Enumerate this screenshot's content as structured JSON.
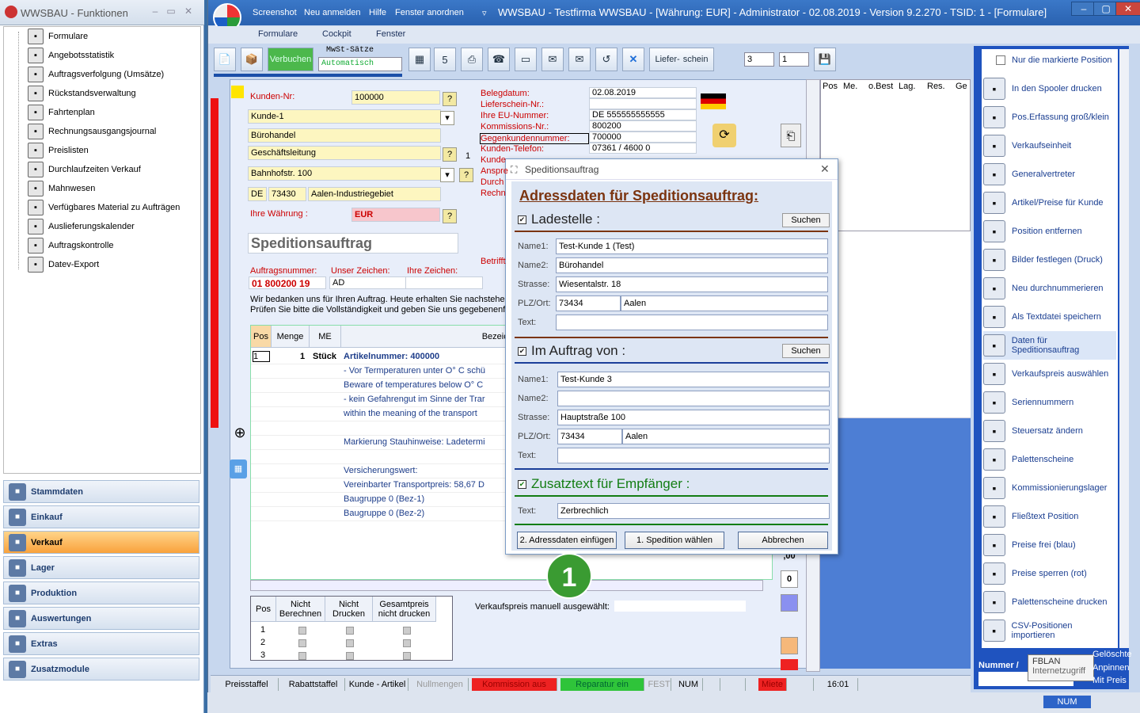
{
  "left_window": {
    "title": "WWSBAU - Funktionen",
    "tree": [
      {
        "label": "Formulare",
        "icon": "document-icon"
      },
      {
        "label": "Angebotsstatistik",
        "icon": "calendar-icon"
      },
      {
        "label": "Auftragsverfolgung (Umsätze)",
        "icon": "percent-icon"
      },
      {
        "label": "Rückstandsverwaltung",
        "icon": "clock-icon"
      },
      {
        "label": "Fahrtenplan",
        "icon": "truck-icon"
      },
      {
        "label": "Rechnungsausgangsjournal",
        "icon": "chart-icon"
      },
      {
        "label": "Preislisten",
        "icon": "tag-icon"
      },
      {
        "label": "Durchlaufzeiten Verkauf",
        "icon": "hourglass-icon"
      },
      {
        "label": "Mahnwesen",
        "icon": "dollar-icon"
      },
      {
        "label": "Verfügbares Material zu Aufträgen",
        "icon": "pen-icon"
      },
      {
        "label": "Auslieferungskalender",
        "icon": "calendar-icon"
      },
      {
        "label": "Auftragskontrolle",
        "icon": "checklist-icon"
      },
      {
        "label": "Datev-Export",
        "icon": "datev-icon"
      }
    ],
    "groups": [
      {
        "label": "Stammdaten",
        "active": false
      },
      {
        "label": "Einkauf",
        "active": false
      },
      {
        "label": "Verkauf",
        "active": true
      },
      {
        "label": "Lager",
        "active": false
      },
      {
        "label": "Produktion",
        "active": false
      },
      {
        "label": "Auswertungen",
        "active": false
      },
      {
        "label": "Extras",
        "active": false
      },
      {
        "label": "Zusatzmodule",
        "active": false
      }
    ]
  },
  "main_window": {
    "title_tabs": [
      "Screenshot",
      "Neu anmelden",
      "Hilfe",
      "Fenster anordnen"
    ],
    "title": "WWSBAU - Testfirma WWSBAU - [Währung: EUR] - Administrator - 02.08.2019 - Version 9.2.270 - TSID: 1 - [Formulare]",
    "menu": [
      "Formulare",
      "Cockpit",
      "Fenster"
    ],
    "toolbar": {
      "verbuchen": "Verbuchen",
      "mwst_label": "MwSt-Sätze",
      "mwst_value": "Automatisch",
      "liefer": "Liefer-",
      "schein": "schein",
      "num1": "3",
      "num2": "1"
    }
  },
  "form": {
    "kunden_nr_label": "Kunden-Nr:",
    "kunden_nr": "100000",
    "name": "Kunde-1",
    "line2": "Bürohandel",
    "line3": "Geschäftsleitung",
    "line3_num": "1",
    "street": "Bahnhofstr. 100",
    "country": "DE",
    "zip": "73430",
    "city": "Aalen-Industriegebiet",
    "currency_label": "Ihre Währung :",
    "currency": "EUR",
    "doc_title": "Speditionsauftrag",
    "right_labels": [
      "Belegdatum:",
      "Lieferschein-Nr.:",
      "Ihre EU-Nummer:",
      "Kommissions-Nr.:",
      "Gegenkundennummer:",
      "Kunden-Telefon:",
      "Kunde",
      "Anspre",
      "Durch",
      "Rechn",
      "Betrifft"
    ],
    "right_values": [
      "02.08.2019",
      "",
      "DE 555555555555",
      "800200",
      "700000",
      "07361 / 4600 0"
    ],
    "order_labels": [
      "Auftragsnummer:",
      "Unser Zeichen:",
      "Ihre Zeichen:"
    ],
    "order_values": [
      "01 800200 19",
      "AD",
      ""
    ],
    "intro1": "Wir bedanken uns für Ihren Auftrag. Heute erhalten Sie nachstehen",
    "intro2": "Prüfen Sie bitte die Vollständigkeit und geben Sie uns gegebenenfall",
    "grid_headers": [
      "Pos",
      "Menge",
      "ME",
      "Bezeichnung"
    ],
    "grid_rows": [
      {
        "pos": "1",
        "menge": "1",
        "me": "Stück",
        "text": "Artikelnummer: 400000",
        "bold": true
      },
      {
        "pos": "",
        "menge": "",
        "me": "",
        "text": "-  Vor Termperaturen unter O° C schü",
        "bold": false
      },
      {
        "pos": "",
        "menge": "",
        "me": "",
        "text": "   Beware of temperatures below O° C",
        "bold": false
      },
      {
        "pos": "",
        "menge": "",
        "me": "",
        "text": "-  kein Gefahrengut im Sinne der Trar",
        "bold": false
      },
      {
        "pos": "",
        "menge": "",
        "me": "",
        "text": "   within the meaning of the transport",
        "bold": false
      },
      {
        "pos": "",
        "menge": "",
        "me": "",
        "text": "",
        "bold": false
      },
      {
        "pos": "",
        "menge": "",
        "me": "",
        "text": "Markierung Stauhinweise:  Ladetermi",
        "bold": false
      },
      {
        "pos": "",
        "menge": "",
        "me": "",
        "text": "",
        "bold": false
      },
      {
        "pos": "",
        "menge": "",
        "me": "",
        "text": "Versicherungswert:",
        "bold": false
      },
      {
        "pos": "",
        "menge": "",
        "me": "",
        "text": "Vereinbarter Transportpreis:   58,67 D",
        "bold": false
      },
      {
        "pos": "",
        "menge": "",
        "me": "",
        "text": "Baugruppe 0  (Bez-1)",
        "bold": false
      },
      {
        "pos": "",
        "menge": "",
        "me": "",
        "text": "Baugruppe 0  (Bez-2)",
        "bold": false
      }
    ],
    "bottom_headers": [
      "Pos",
      "Nicht Berechnen",
      "Nicht Drucken",
      "Gesamtpreis nicht drucken"
    ],
    "bottom_rows": [
      "1",
      "2",
      "3"
    ],
    "vk_label": "Verkaufspreis manuell ausgewählt:",
    "side_values": [
      ",00",
      "0"
    ],
    "pos_header": [
      "Pos",
      "Me.",
      "o.Best",
      "Lag.",
      "Res.",
      "Ge"
    ]
  },
  "dialog": {
    "title": "Speditionsauftrag",
    "heading": "Adressdaten für Speditionsauftrag:",
    "sections": [
      {
        "title": "Ladestelle :",
        "checked": true,
        "search": "Suchen",
        "name1": "Test-Kunde 1 (Test)",
        "name2": "Bürohandel",
        "strasse": "Wiesentalstr. 18",
        "plz": "73434",
        "ort": "Aalen",
        "text": ""
      },
      {
        "title": "Im Auftrag von :",
        "checked": true,
        "search": "Suchen",
        "name1": "Test-Kunde 3",
        "name2": "",
        "strasse": "Hauptstraße 100",
        "plz": "73434",
        "ort": "Aalen",
        "text": ""
      }
    ],
    "labels": {
      "name1": "Name1:",
      "name2": "Name2:",
      "strasse": "Strasse:",
      "plzort": "PLZ/Ort:",
      "text": "Text:"
    },
    "zusatz_title": "Zusatztext für Empfänger :",
    "zusatz_text": "Zerbrechlich",
    "buttons": [
      "2. Adressdaten einfügen",
      "1. Spedition wählen",
      "Abbrechen"
    ]
  },
  "right_panel": {
    "checkbox": "Nur die markierte Position",
    "items": [
      {
        "label": "In den Spooler drucken",
        "icon": "printer-icon"
      },
      {
        "label": "Pos.Erfassung groß/klein",
        "icon": "keyboard-icon"
      },
      {
        "label": "Verkaufseinheit",
        "icon": "cash-register-icon"
      },
      {
        "label": "Generalvertreter",
        "icon": "person-icon"
      },
      {
        "label": "Artikel/Preise für Kunde",
        "icon": "box-icon"
      },
      {
        "label": "Position entfernen",
        "icon": "delete-icon"
      },
      {
        "label": "Bilder festlegen (Druck)",
        "icon": "image-icon"
      },
      {
        "label": "Neu durchnummerieren",
        "icon": "sort-icon"
      },
      {
        "label": "Als Textdatei speichern",
        "icon": "save-icon"
      },
      {
        "label": "Daten für Speditionsauftrag",
        "icon": "info-icon"
      },
      {
        "label": "Verkaufspreis auswählen",
        "icon": "price-tag-icon"
      },
      {
        "label": "Seriennummern",
        "icon": "stamp-icon"
      },
      {
        "label": "Steuersatz ändern",
        "icon": "percent-icon"
      },
      {
        "label": "Palettenscheine",
        "icon": "pallet-icon"
      },
      {
        "label": "Kommissionierungslager",
        "icon": "globe-icon"
      },
      {
        "label": "Fließtext Position",
        "icon": "text-icon"
      },
      {
        "label": "Preise frei (blau)",
        "icon": "tag-blue-icon"
      },
      {
        "label": "Preise sperren (rot)",
        "icon": "tag-red-icon"
      },
      {
        "label": "Palettenscheine drucken",
        "icon": "printer-icon"
      },
      {
        "label": "CSV-Positionen importieren",
        "icon": "csv-icon"
      }
    ],
    "nummer_label": "Nummer /",
    "tooltip_title": "FBLAN",
    "tooltip_sub": "Internetzugriff",
    "opts": [
      "Gelöschte",
      "Anpinnen",
      "Mit Preis"
    ]
  },
  "statusbar": {
    "items": [
      "Preisstaffel",
      "Rabattstaffel",
      "Kunde - Artikel",
      "Nullmengen",
      "Kommission aus",
      "Reparatur ein",
      "FEST",
      "NUM",
      "",
      "",
      "Miete",
      "",
      "16:01"
    ],
    "num_right": "NUM"
  },
  "badge": "1"
}
